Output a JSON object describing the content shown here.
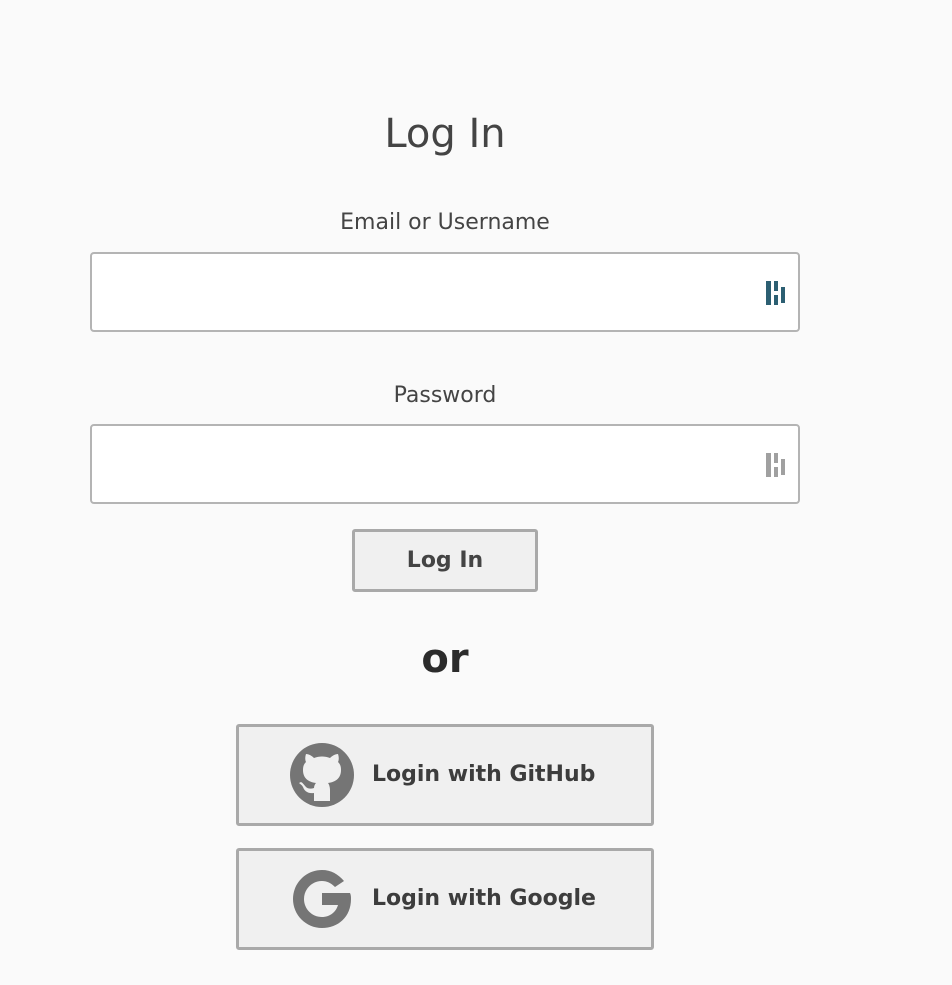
{
  "form": {
    "title": "Log In",
    "email_label": "Email or Username",
    "email_value": "",
    "password_label": "Password",
    "password_value": "",
    "submit_label": "Log In",
    "separator": "or"
  },
  "oauth": {
    "github_label": "Login with GitHub",
    "github_icon": "github-icon",
    "google_label": "Login with Google",
    "google_icon": "google-icon"
  },
  "icons": {
    "password_manager": "password-manager-icon"
  },
  "colors": {
    "background": "#fafafa",
    "text": "#444444",
    "button_bg": "#f0f0f0",
    "button_border": "#a9a9a9",
    "input_border": "#b4b4b4",
    "pm_icon_active": "#2c5f72",
    "pm_icon_inactive": "#a0a0a0",
    "oauth_icon": "#757575"
  }
}
